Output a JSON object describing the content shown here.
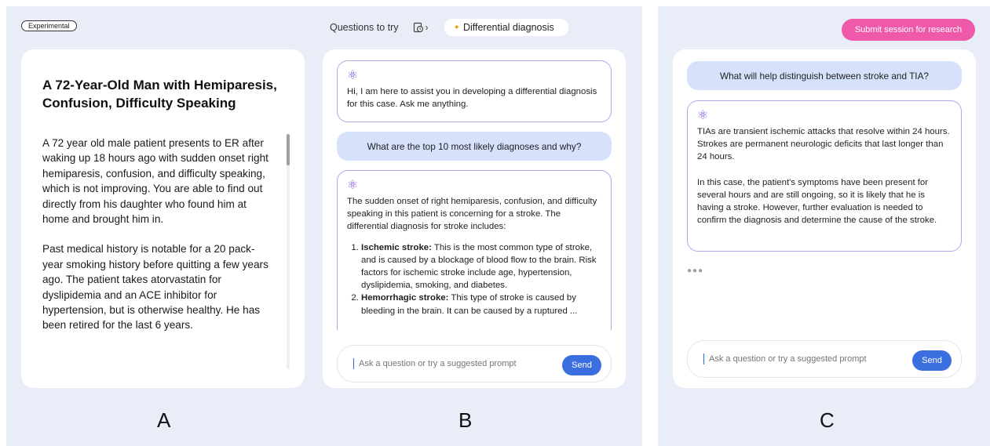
{
  "header": {
    "badge": "Experimental",
    "questions_label": "Questions to try",
    "history_icon": "history-icon",
    "chip_label": "Differential diagnosis",
    "chip_icon": "sparkle-icon"
  },
  "case": {
    "title": "A 72-Year-Old Man with Hemiparesis, Confusion, Difficulty Speaking",
    "paragraph1": "A 72 year old male patient presents to ER after waking up 18 hours ago with sudden onset right hemiparesis, confusion, and difficulty speaking, which is not improving. You are able to find out directly from his daughter who found him at home and brought him in.",
    "paragraph2": "Past medical history is notable for a 20 pack-year smoking history before quitting a few years ago. The patient takes atorvastatin for dyslipidemia and an ACE inhibitor for hypertension, but is otherwise healthy. He has been retired for the last 6 years."
  },
  "chat_b": {
    "greeting": "Hi, I am here to assist you in developing a differential diagnosis for this case. Ask me anything.",
    "user_question": "What are the top 10 most likely diagnoses and why?",
    "answer_intro": "The sudden onset of right hemiparesis, confusion, and difficulty speaking in this patient is concerning for a stroke. The differential diagnosis for stroke includes:",
    "answer_items": [
      {
        "bold": "Ischemic stroke:",
        "text": " This is the most common type of stroke, and is caused by a blockage of blood flow to the brain. Risk factors for ischemic stroke include age, hypertension, dyslipidemia, smoking, and diabetes."
      },
      {
        "bold": "Hemorrhagic stroke:",
        "text": " This type of stroke is caused by bleeding in the brain. It can be caused by a ruptured ..."
      }
    ],
    "input_placeholder": "Ask a question or try a suggested prompt",
    "send_label": "Send"
  },
  "chat_c": {
    "submit_label": "Submit session for research",
    "user_question": "What will help distinguish between stroke and TIA?",
    "answer_p1": "TIAs are transient ischemic attacks that resolve within 24 hours. Strokes are permanent neurologic deficits that last longer than 24 hours.",
    "answer_p2": "In this case, the patient's symptoms have been present for several hours and are still ongoing, so it is likely that he is having a stroke. However, further evaluation is needed to confirm the diagnosis and determine the cause of the stroke.",
    "typing_indicator": "●●●",
    "input_placeholder": "Ask a question or try a suggested prompt",
    "send_label": "Send"
  },
  "labels": {
    "a": "A",
    "b": "B",
    "c": "C"
  },
  "colors": {
    "panel_bg": "#e9edf7",
    "user_bubble": "#d6e2fb",
    "send_button": "#3b6fe0",
    "submit_button": "#ee5aa9",
    "ai_border": "#b9a4e6"
  }
}
